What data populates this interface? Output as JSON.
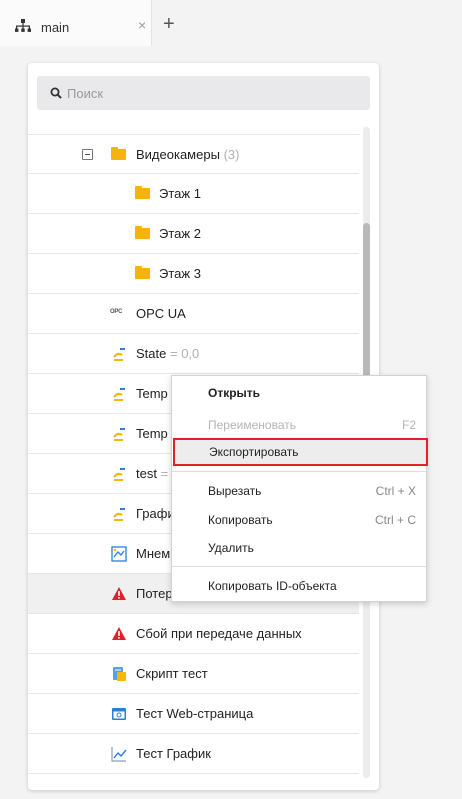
{
  "tabs": [
    {
      "label": "main"
    }
  ],
  "tab_close": "×",
  "tab_add": "+",
  "search": {
    "placeholder": "Поиск"
  },
  "tree": [
    {
      "name": "Видеокамеры",
      "suffix": "(3)",
      "icon": "folder-icon",
      "level": 1,
      "expanded": true
    },
    {
      "name": "Этаж 1",
      "suffix": "",
      "icon": "folder-icon",
      "level": 2
    },
    {
      "name": "Этаж 2",
      "suffix": "",
      "icon": "folder-icon",
      "level": 2
    },
    {
      "name": "Этаж 3",
      "suffix": "",
      "icon": "folder-icon",
      "level": 2
    },
    {
      "name": "OPC UA",
      "suffix": "",
      "icon": "opc-icon",
      "icon_text": "OPC",
      "level": 1
    },
    {
      "name": "State",
      "suffix": "= 0,0",
      "icon": "signal-icon",
      "level": 1
    },
    {
      "name": "Temp",
      "suffix": "",
      "icon": "signal-icon",
      "level": 1
    },
    {
      "name": "Temp",
      "suffix": "",
      "icon": "signal-icon",
      "level": 1
    },
    {
      "name": "test",
      "suffix": "=",
      "icon": "signal-icon",
      "level": 1
    },
    {
      "name": "Графи",
      "suffix": "",
      "icon": "signal-icon",
      "level": 1
    },
    {
      "name": "Мнем",
      "suffix": "",
      "icon": "mnemo-icon",
      "level": 1
    },
    {
      "name": "Потер",
      "suffix": "",
      "icon": "warning-icon",
      "level": 1,
      "selected": true
    },
    {
      "name": "Сбой при передаче данных",
      "suffix": "",
      "icon": "warning-icon",
      "level": 1
    },
    {
      "name": "Скрипт тест",
      "suffix": "",
      "icon": "script-icon",
      "level": 1
    },
    {
      "name": "Тест Web-страница",
      "suffix": "",
      "icon": "web-page-icon",
      "level": 1
    },
    {
      "name": "Тест График",
      "suffix": "",
      "icon": "chart-icon",
      "level": 1
    }
  ],
  "context_menu": {
    "open": "Открыть",
    "rename": "Переименовать",
    "rename_shortcut": "F2",
    "export": "Экспортировать",
    "cut": "Вырезать",
    "cut_shortcut": "Ctrl + X",
    "copy": "Копировать",
    "copy_shortcut": "Ctrl + C",
    "delete": "Удалить",
    "copy_id": "Копировать ID-объекта"
  },
  "colors": {
    "folder": "#f6b20d",
    "warning": "#e0212b",
    "highlight_border": "#e0212b",
    "signal_yellow": "#f5b800",
    "signal_blue": "#2b7fd9"
  }
}
